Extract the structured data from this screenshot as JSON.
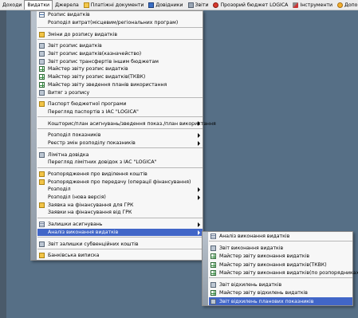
{
  "menubar": {
    "items": [
      {
        "label": "Доходи",
        "icon": "none"
      },
      {
        "label": "Видатки",
        "icon": "none",
        "active": true
      },
      {
        "label": "Джерела",
        "icon": "none"
      },
      {
        "label": "Платіжні документи",
        "icon": "folder-icon"
      },
      {
        "label": "Довідники",
        "icon": "book-icon"
      },
      {
        "label": "Звіти",
        "icon": "printer-icon"
      },
      {
        "label": "Прозорий бюджет  LOGICA",
        "icon": "red-circle-icon"
      },
      {
        "label": "Інструменти",
        "icon": "wrench-icon"
      },
      {
        "label": "Допомога",
        "icon": "help-icon"
      }
    ]
  },
  "main_menu": {
    "items": [
      {
        "label": "Розпис видатків",
        "icon": "table"
      },
      {
        "label": "Розподіл витрат(місцевим/регіональних програм)",
        "icon": "blank"
      },
      {
        "sep": true
      },
      {
        "label": "Зміни до розпису видатків",
        "icon": "folder"
      },
      {
        "sep": true
      },
      {
        "label": "Звіт розпис видатків",
        "icon": "printer"
      },
      {
        "label": "Звіт розпис видатків(казначейство)",
        "icon": "printer"
      },
      {
        "label": "Звіт розпис трансфертів іншим бюджетам",
        "icon": "printer"
      },
      {
        "label": "Майстер звіту розпис видатків",
        "icon": "grid"
      },
      {
        "label": "Майстер звіту розпис видатків(ТКВК)",
        "icon": "grid"
      },
      {
        "label": "Майстер звіту зведення планів використання",
        "icon": "grid"
      },
      {
        "label": "Витяг з розпису",
        "icon": "printer"
      },
      {
        "sep": true
      },
      {
        "label": "Паспорт бюджетної програми",
        "icon": "folder"
      },
      {
        "label": "Перегляд паспортів  з ІАС \"LOGICA\"",
        "icon": "blank"
      },
      {
        "sep": true
      },
      {
        "label": "Кошторис/план асигнувань/зведення показ./план використання",
        "icon": "blank",
        "submenu": true
      },
      {
        "sep": true
      },
      {
        "label": "Розподіл показників",
        "icon": "blank",
        "submenu": true
      },
      {
        "label": "Реєстр змін розподілу показників",
        "icon": "blank",
        "submenu": true
      },
      {
        "sep": true
      },
      {
        "label": "Лімітна довідка",
        "icon": "printer"
      },
      {
        "label": "Перегляд лімітних довідок  з ІАС \"LOGICA\"",
        "icon": "blank"
      },
      {
        "sep": true
      },
      {
        "label": "Розпорядження про виділення коштів",
        "icon": "folder"
      },
      {
        "label": "Розпорядження про передачу (операції фінансування)",
        "icon": "folder"
      },
      {
        "label": "Розподіл",
        "icon": "blank",
        "submenu": true
      },
      {
        "label": "Розподіл (нова версія)",
        "icon": "blank",
        "submenu": true
      },
      {
        "label": "Заявка на фінансування для ГРК",
        "icon": "folder"
      },
      {
        "label": "Заявки на фінансування від ГРК",
        "icon": "blank"
      },
      {
        "sep": true
      },
      {
        "label": "Залишки асигнувань",
        "icon": "list",
        "submenu": true
      },
      {
        "label": "Аналіз виконання видатків",
        "icon": "blank",
        "submenu": true,
        "highlight": true
      },
      {
        "sep": true
      },
      {
        "label": "Звіт залишки субвенційних коштів",
        "icon": "printer"
      },
      {
        "sep": true
      },
      {
        "label": "Банківська виписка",
        "icon": "folder"
      }
    ]
  },
  "sub_menu": {
    "items": [
      {
        "label": "Аналіз виконання видатків",
        "icon": "list"
      },
      {
        "sep": true
      },
      {
        "label": "Звіт виконання видатків",
        "icon": "printer"
      },
      {
        "label": "Майстер звіту виконання видатків",
        "icon": "grid"
      },
      {
        "label": "Майстер звіту виконання видатків(ТКВК)",
        "icon": "grid"
      },
      {
        "label": "Майстер звіту виконання видатків(по розпорядниках)",
        "icon": "grid"
      },
      {
        "sep": true
      },
      {
        "label": "Звіт відхилень видатків",
        "icon": "printer"
      },
      {
        "label": "Майстер звіту відхилень видатків",
        "icon": "grid"
      },
      {
        "label": "Звіт відхилень планових показників",
        "icon": "printer",
        "highlight": true
      }
    ]
  }
}
